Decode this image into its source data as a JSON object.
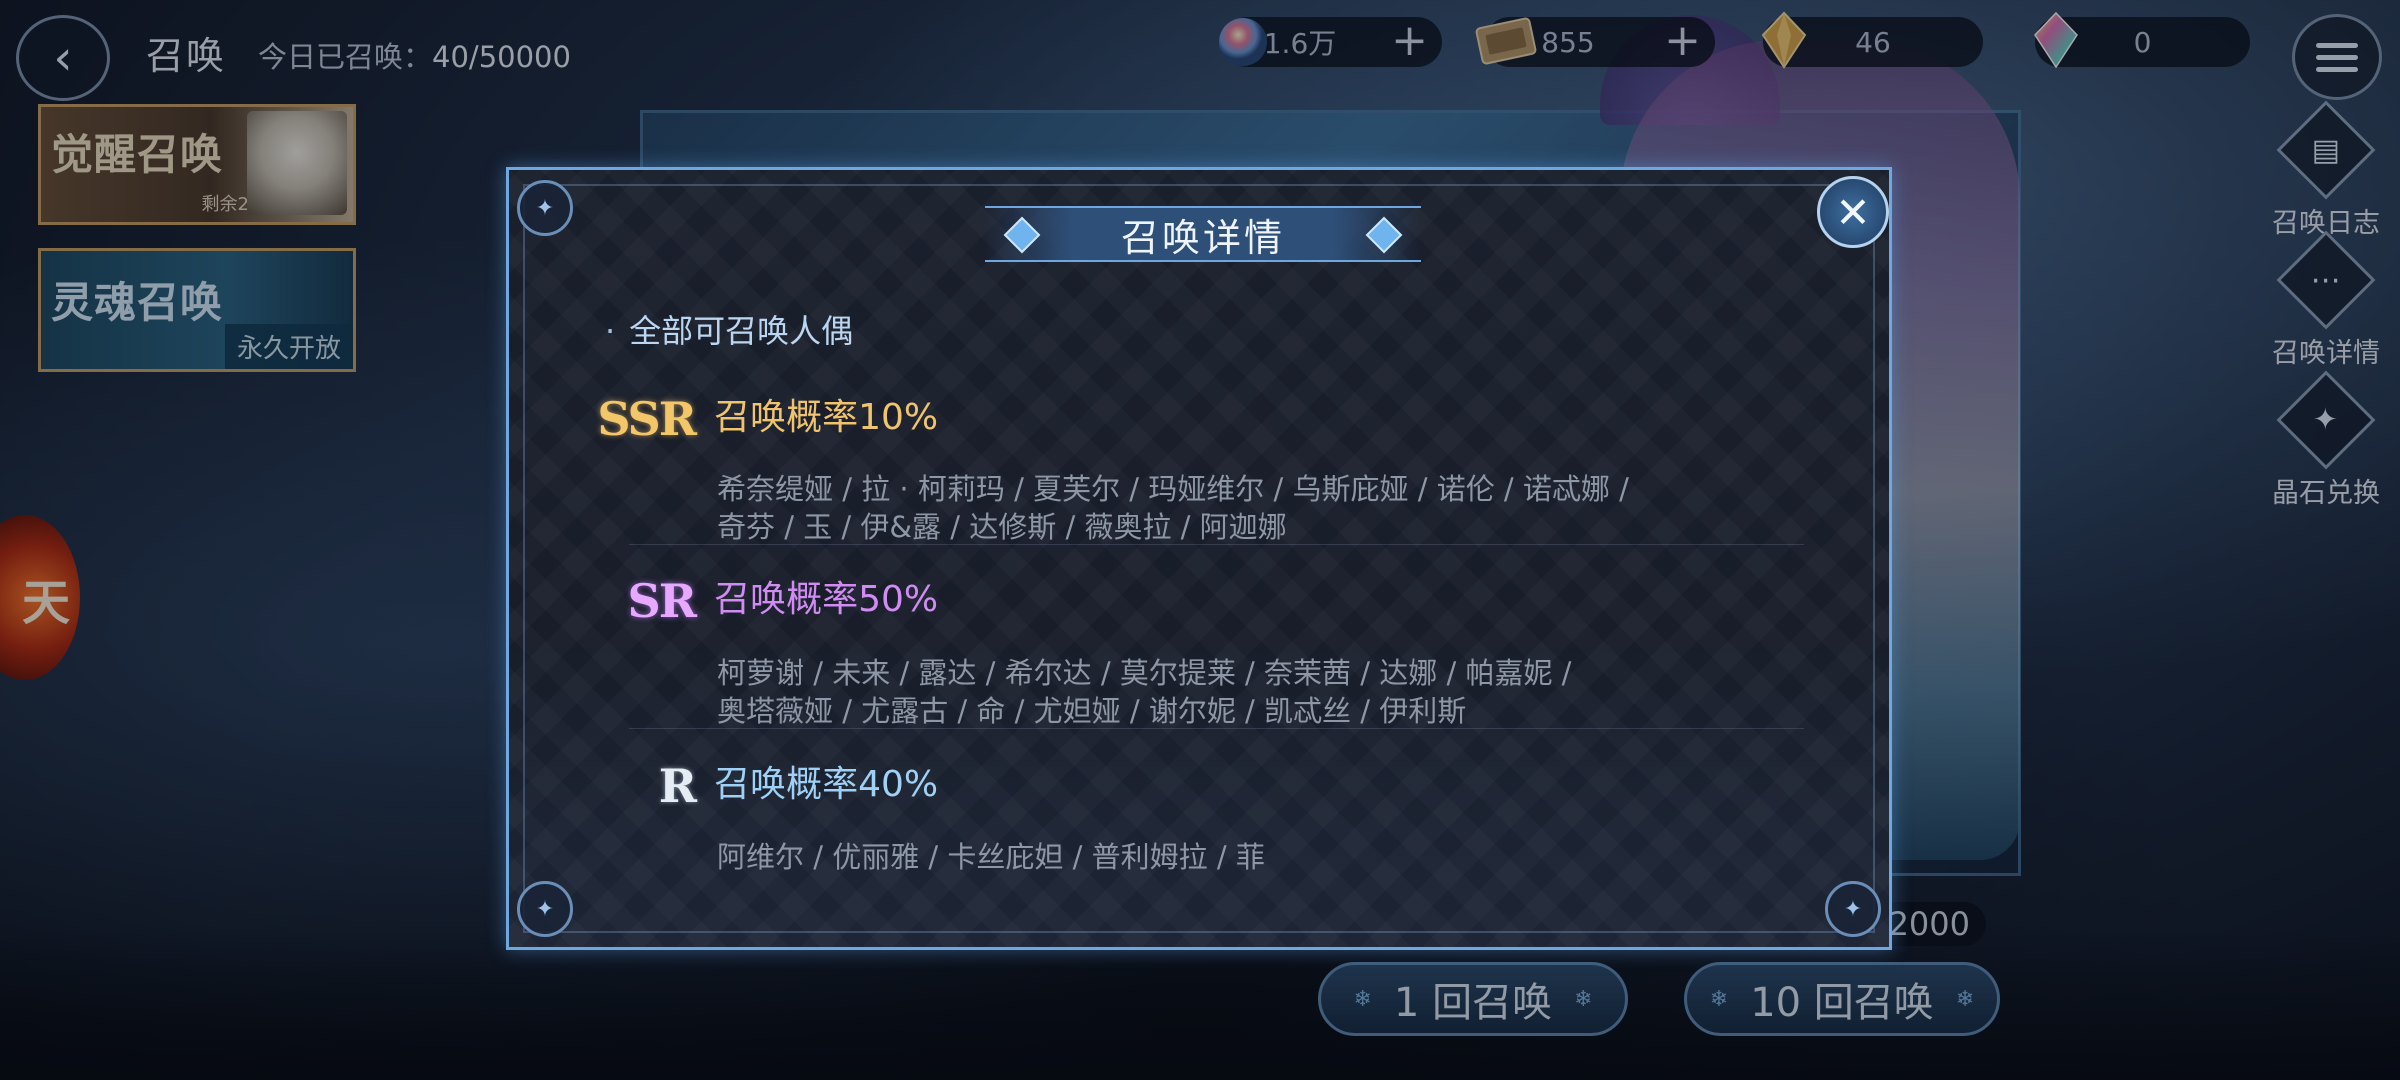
{
  "header": {
    "title": "召唤",
    "today_label": "今日已召唤：",
    "today_value": "40/50000"
  },
  "resources": [
    {
      "icon": "rainbow-orb-icon",
      "value": "1.6万",
      "has_plus": true
    },
    {
      "icon": "ticket-icon",
      "value": "855",
      "has_plus": true
    },
    {
      "icon": "gold-crystal-icon",
      "value": "46",
      "has_plus": false
    },
    {
      "icon": "rainbow-crystal-icon",
      "value": "0",
      "has_plus": false
    }
  ],
  "left_tabs": [
    {
      "title": "觉醒召唤",
      "sub": "剩余2天"
    },
    {
      "title": "灵魂召唤",
      "sub": "永久开放"
    }
  ],
  "side_orb_text": "天",
  "right_buttons": [
    {
      "icon": "log-book-icon",
      "label": "召唤日志"
    },
    {
      "icon": "more-dots-icon",
      "label": "召唤详情"
    },
    {
      "icon": "crystal-exchange-icon",
      "label": "晶石兑换"
    }
  ],
  "bottom": {
    "cost_value": "2000",
    "single_label": "1 回召唤",
    "ten_label": "10 回召唤"
  },
  "modal": {
    "title": "召唤详情",
    "close_symbol": "✕",
    "section_title": "全部可召唤人偶",
    "rarities": [
      {
        "badge": "SSR",
        "rate_text": "召唤概率10%",
        "rate_percent": 10,
        "color": "#f0c46e",
        "names_line1": "希奈缇娅 / 拉 · 柯莉玛 / 夏芙尔 / 玛娅维尔 / 乌斯庇娅 / 诺伦 / 诺忒娜 /",
        "names_line2": "奇芬 / 玉 / 伊&露 / 达修斯 / 薇奥拉 / 阿迦娜"
      },
      {
        "badge": "SR",
        "rate_text": "召唤概率50%",
        "rate_percent": 50,
        "color": "#d08cf2",
        "names_line1": "柯萝谢 / 未来 / 露达 / 希尔达 / 莫尔提莱 / 奈茉茜 / 达娜 / 帕嘉妮 /",
        "names_line2": "奥塔薇娅 / 尤露古 / 命 / 尤妲娅 / 谢尔妮 / 凯忒丝 / 伊利斯"
      },
      {
        "badge": "R",
        "rate_text": "召唤概率40%",
        "rate_percent": 40,
        "color": "#9fd0f5",
        "names_line1": "阿维尔 / 优丽雅 / 卡丝庇妲 / 普利姆拉 / 菲",
        "names_line2": ""
      }
    ]
  }
}
